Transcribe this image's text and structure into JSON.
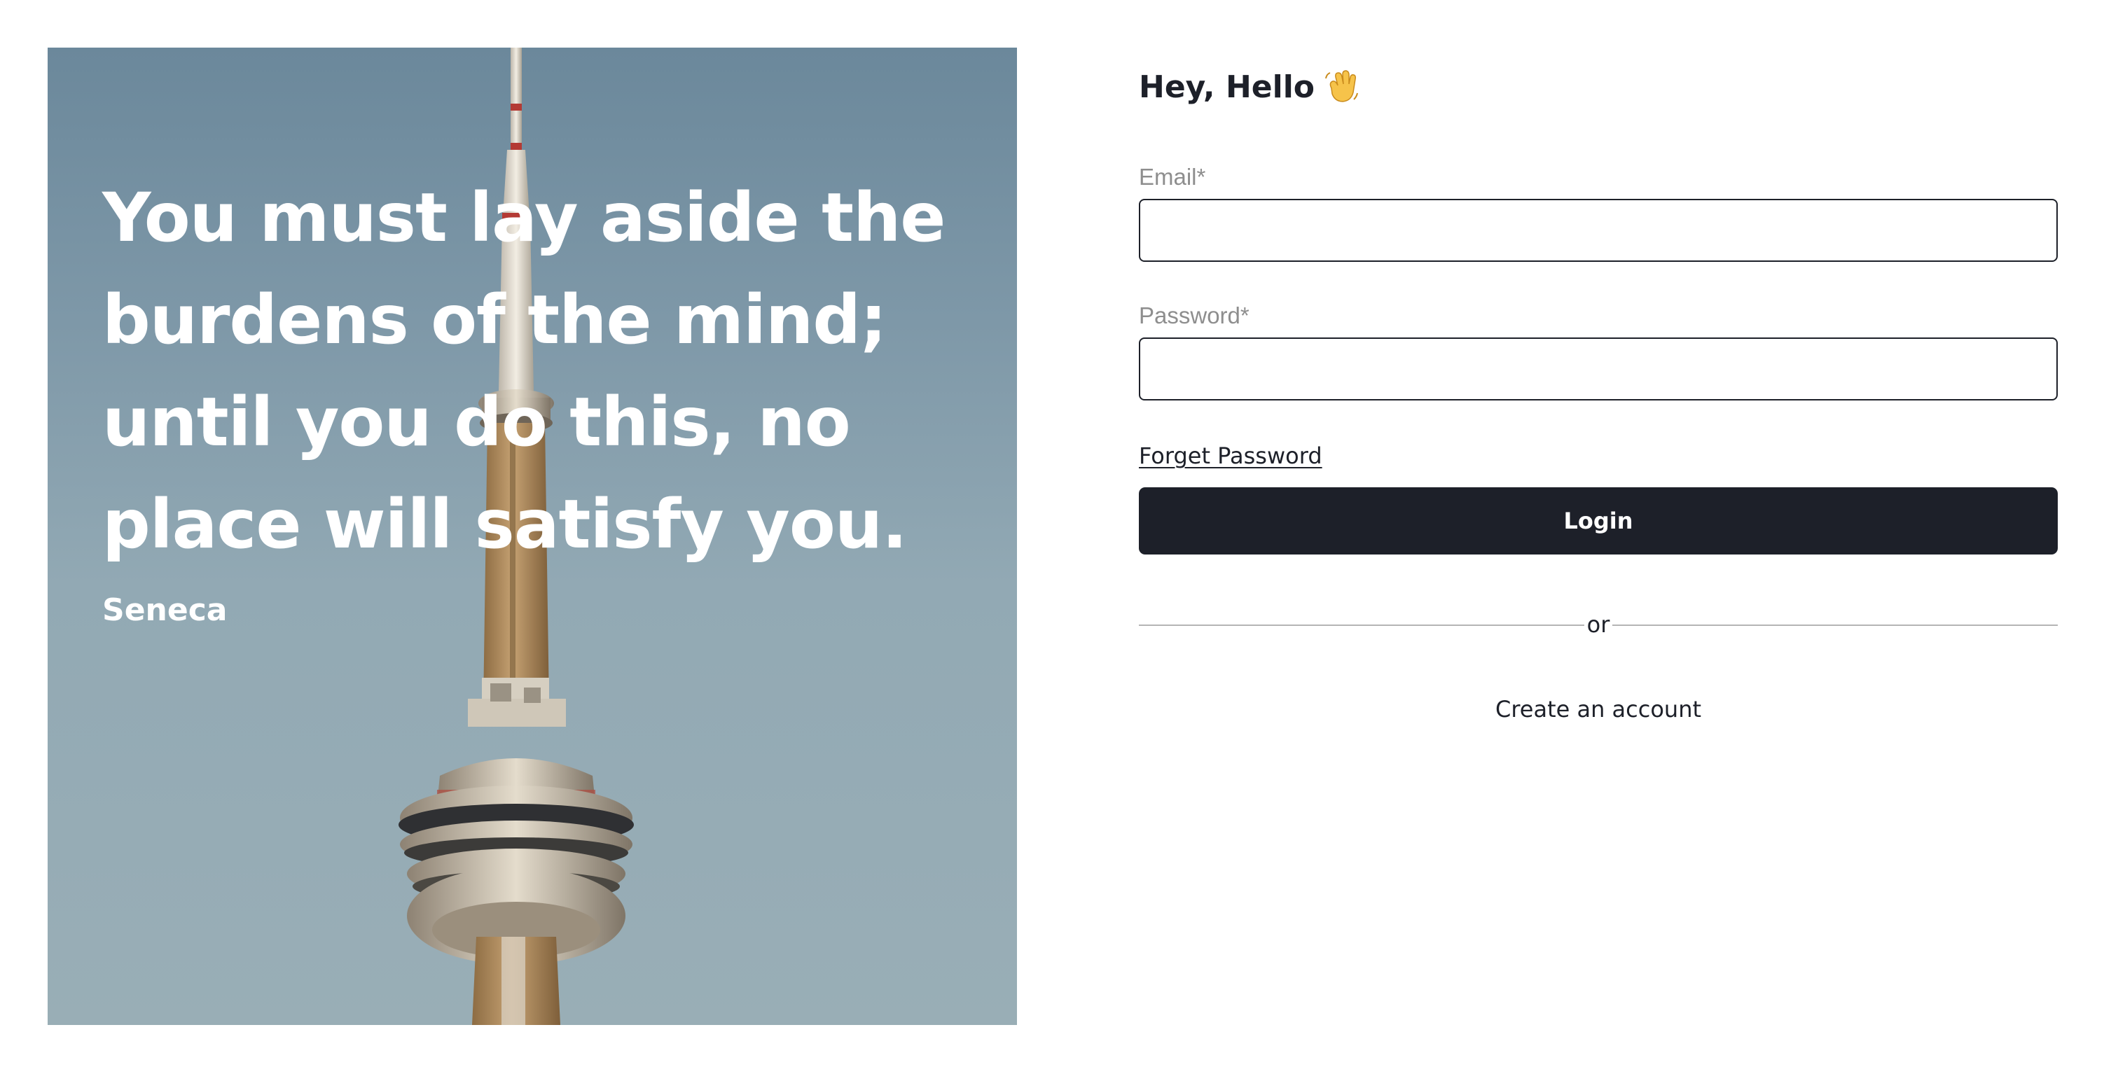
{
  "hero": {
    "quote": "You must lay aside the burdens of the mind; until you do this, no place will satisfy you.",
    "author": "Seneca",
    "image_subject": "tower-photo"
  },
  "form": {
    "greeting": "Hey, Hello",
    "greeting_icon": "waving-hand-icon",
    "email_label": "Email*",
    "email_value": "",
    "password_label": "Password*",
    "password_value": "",
    "forgot_password": "Forget Password",
    "login_label": "Login",
    "divider_text": "or",
    "create_account": "Create an account"
  },
  "colors": {
    "primary": "#1d2029",
    "label": "#8e8e8e",
    "sky_top": "#6b889b",
    "sky_bottom": "#99aeb6",
    "tower": "#b08e5c"
  }
}
